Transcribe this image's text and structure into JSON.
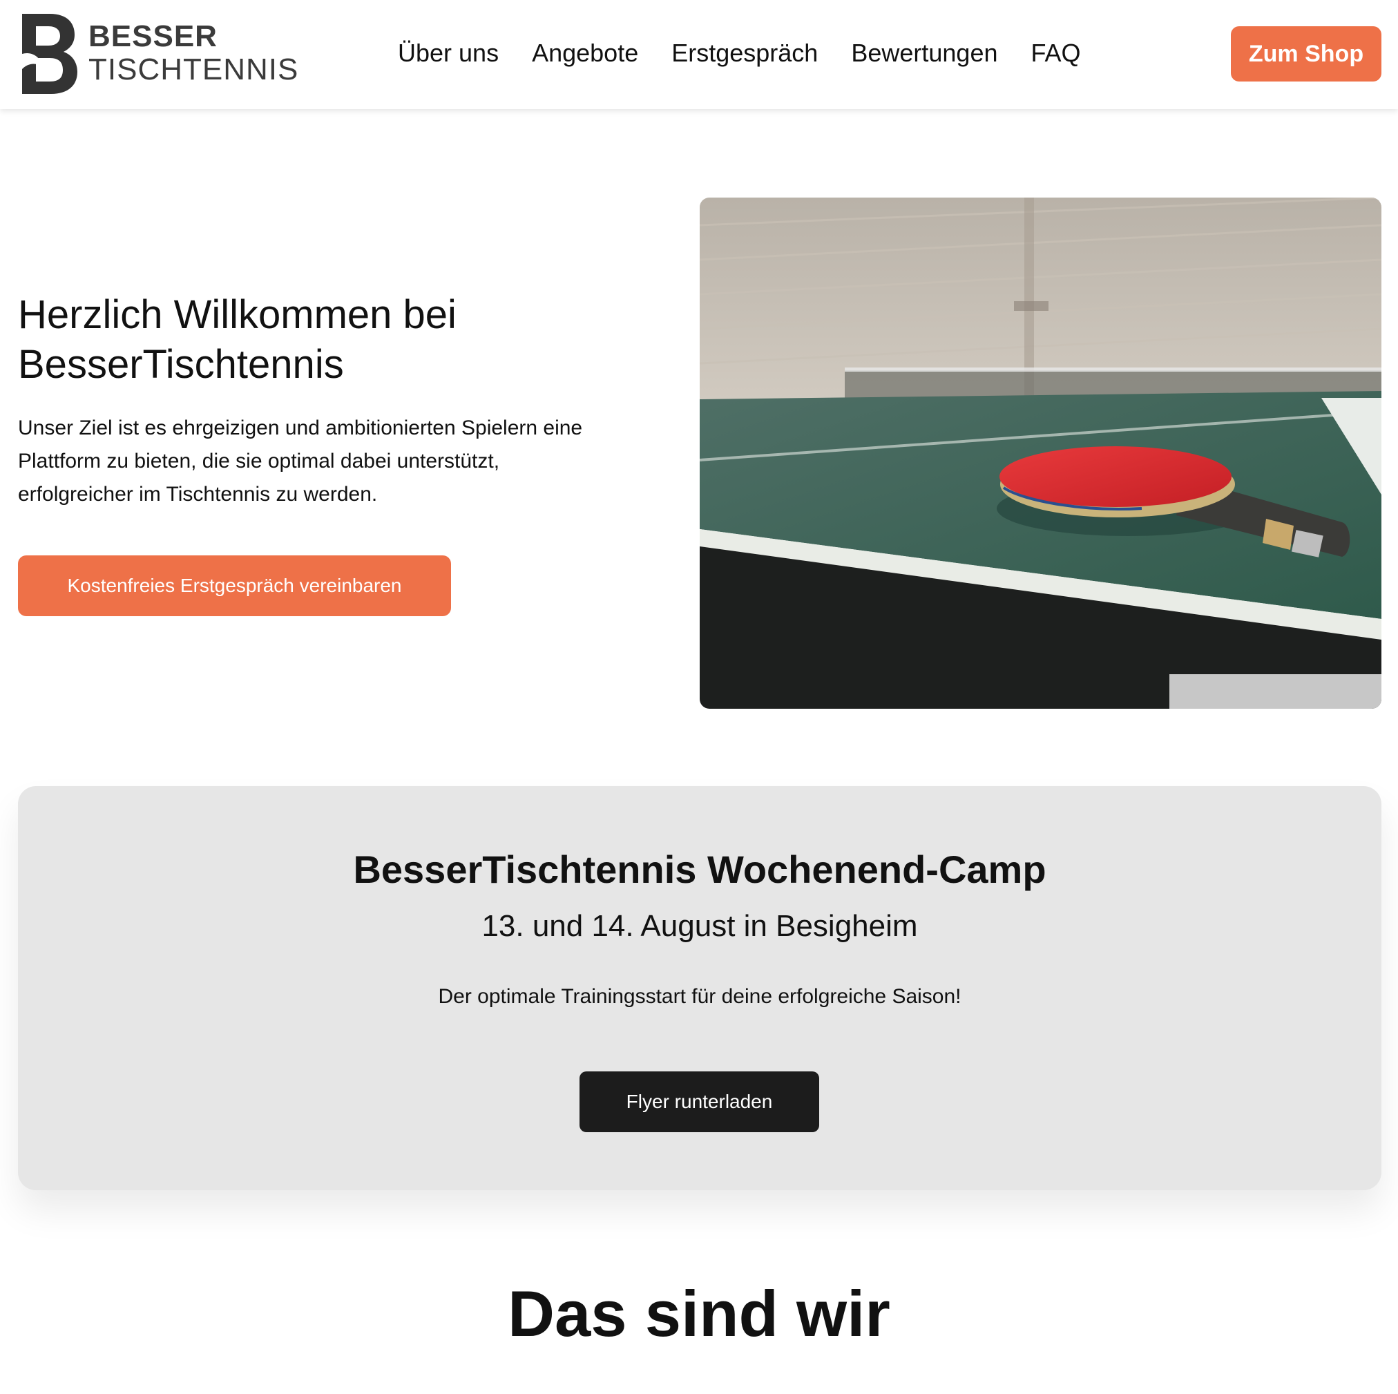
{
  "header": {
    "logo_line1": "BESSER",
    "logo_line2": "TISCHTENNIS",
    "nav": [
      "Über uns",
      "Angebote",
      "Erstgespräch",
      "Bewertungen",
      "FAQ"
    ],
    "shop_label": "Zum Shop"
  },
  "hero": {
    "title_line1": "Herzlich Willkommen bei",
    "title_line2": "BesserTischtennis",
    "text_line1": "Unser Ziel ist es ehrgeizigen und ambitionierten Spielern eine",
    "text_line2": "Plattform zu bieten, die sie optimal dabei unterstützt,",
    "text_line3": "erfolgreicher im Tischtennis zu werden.",
    "cta_label": "Kostenfreies Erstgespräch vereinbaren"
  },
  "camp": {
    "title": "BesserTischtennis Wochenend-Camp",
    "date": "13. und 14. August in Besigheim",
    "text": "Der optimale Trainingsstart für deine erfolgreiche Saison!",
    "button_label": "Flyer runterladen"
  },
  "about": {
    "title": "Das sind wir"
  },
  "colors": {
    "accent": "#ee7148",
    "dark_button": "#1c1c1c",
    "card_bg": "#e6e6e6"
  }
}
